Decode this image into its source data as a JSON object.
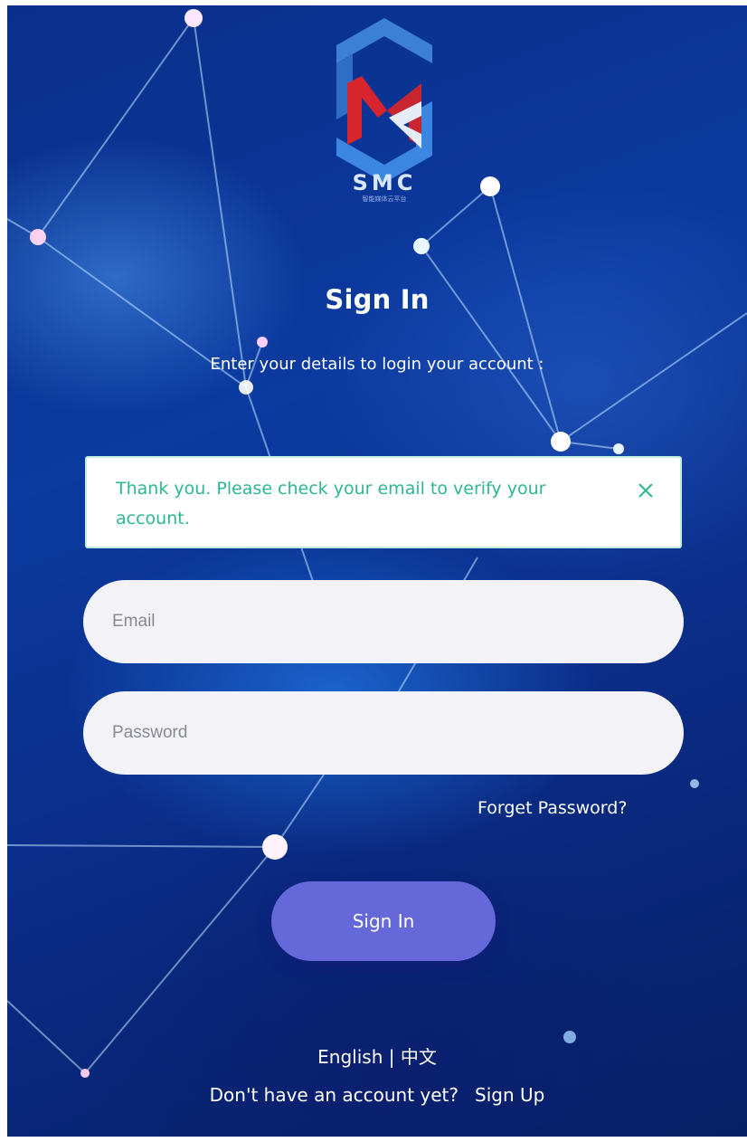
{
  "logo": {
    "brand": "SMC",
    "tagline": "智能媒体云平台"
  },
  "header": {
    "title": "Sign In",
    "subtitle": "Enter your details to login your account :"
  },
  "alert": {
    "message": "Thank you. Please check your email to verify your account.",
    "close_icon": "close-icon",
    "color": "#2db88f"
  },
  "form": {
    "email": {
      "value": "",
      "placeholder": "Email"
    },
    "password": {
      "value": "",
      "placeholder": "Password"
    },
    "forgot_label": "Forget Password?",
    "submit_label": "Sign In",
    "button_color": "#6568d8"
  },
  "footer": {
    "lang_english": "English",
    "lang_separator": "|",
    "lang_chinese": "中文",
    "no_account_text": "Don't have an account yet?",
    "signup_label": "Sign Up"
  }
}
